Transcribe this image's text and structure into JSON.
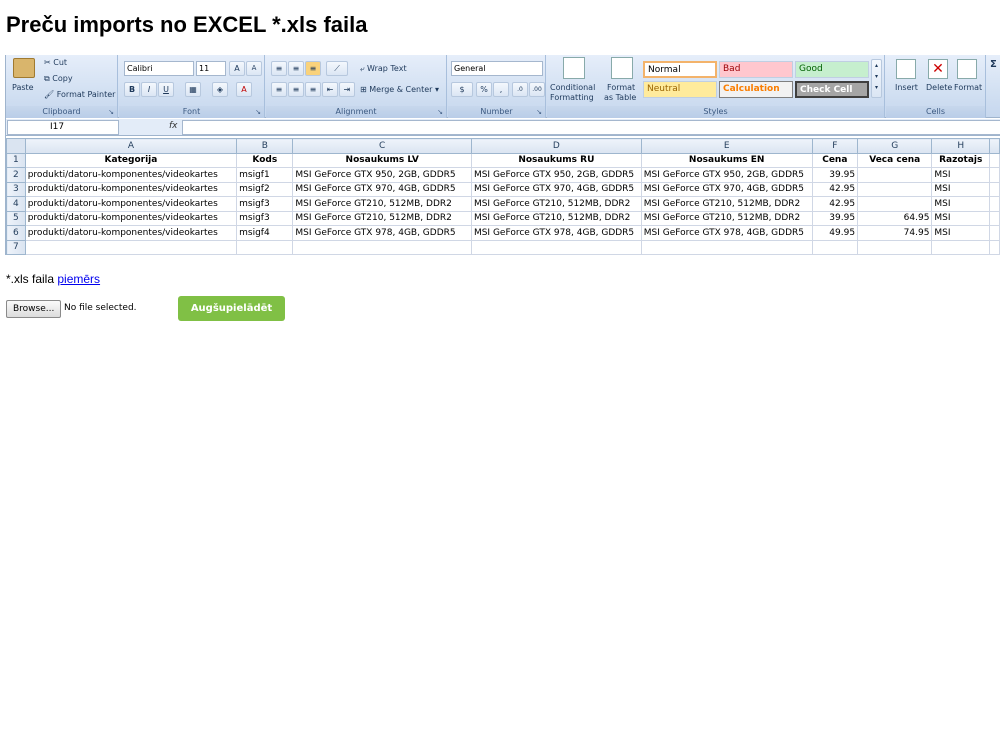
{
  "page": {
    "title": "Preču imports no EXCEL *.xls faila",
    "sample_prefix": "*.xls faila",
    "sample_link": "piemērs",
    "browse_label": "Browse...",
    "no_file_text": "No file selected.",
    "upload_label": "Augšupielādēt",
    "upload_color": "#80c045"
  },
  "excel": {
    "ribbon": {
      "clipboard": {
        "paste": "Paste",
        "cut": "Cut",
        "copy": "Copy",
        "format_painter": "Format Painter",
        "label": "Clipboard"
      },
      "font": {
        "name": "Calibri",
        "size": "11",
        "label": "Font"
      },
      "alignment": {
        "wrap_text": "Wrap Text",
        "merge_center": "Merge & Center",
        "label": "Alignment"
      },
      "number": {
        "format": "General",
        "label": "Number"
      },
      "styles": {
        "conditional_1": "Conditional",
        "conditional_2": "Formatting",
        "format_table_1": "Format",
        "format_table_2": "as Table",
        "normal": "Normal",
        "bad": "Bad",
        "good": "Good",
        "neutral": "Neutral",
        "calculation": "Calculation",
        "check_cell": "Check Cell",
        "label": "Styles"
      },
      "cells": {
        "insert": "Insert",
        "delete": "Delete",
        "format": "Format",
        "label": "Cells"
      }
    },
    "name_box": "I17",
    "fx": "fx",
    "columns": [
      "A",
      "B",
      "C",
      "D",
      "E",
      "F",
      "G",
      "H"
    ],
    "row_numbers": [
      "1",
      "2",
      "3",
      "4",
      "5",
      "6",
      "7"
    ],
    "headers": [
      "Kategorija",
      "Kods",
      "Nosaukums LV",
      "Nosaukums RU",
      "Nosaukums EN",
      "Cena",
      "Veca cena",
      "Razotajs"
    ],
    "rows": [
      [
        "produkti/datoru-komponentes/videokartes",
        "msigf1",
        "MSI GeForce GTX 950, 2GB, GDDR5",
        "MSI GeForce GTX 950, 2GB, GDDR5",
        "MSI GeForce GTX 950, 2GB, GDDR5",
        "39.95",
        "",
        "MSI"
      ],
      [
        "produkti/datoru-komponentes/videokartes",
        "msigf2",
        "MSI GeForce GTX 970, 4GB, GDDR5",
        "MSI GeForce GTX 970, 4GB, GDDR5",
        "MSI GeForce GTX 970, 4GB, GDDR5",
        "42.95",
        "",
        "MSI"
      ],
      [
        "produkti/datoru-komponentes/videokartes",
        "msigf3",
        "MSI GeForce GT210, 512MB, DDR2",
        "MSI GeForce GT210, 512MB, DDR2",
        "MSI GeForce GT210, 512MB, DDR2",
        "42.95",
        "",
        "MSI"
      ],
      [
        "produkti/datoru-komponentes/videokartes",
        "msigf3",
        "MSI GeForce GT210, 512MB, DDR2",
        "MSI GeForce GT210, 512MB, DDR2",
        "MSI GeForce GT210, 512MB, DDR2",
        "39.95",
        "64.95",
        "MSI"
      ],
      [
        "produkti/datoru-komponentes/videokartes",
        "msigf4",
        "MSI GeForce GTX 978, 4GB, GDDR5",
        "MSI GeForce GTX 978, 4GB, GDDR5",
        "MSI GeForce GTX 978, 4GB, GDDR5",
        "49.95",
        "74.95",
        "MSI"
      ]
    ]
  }
}
